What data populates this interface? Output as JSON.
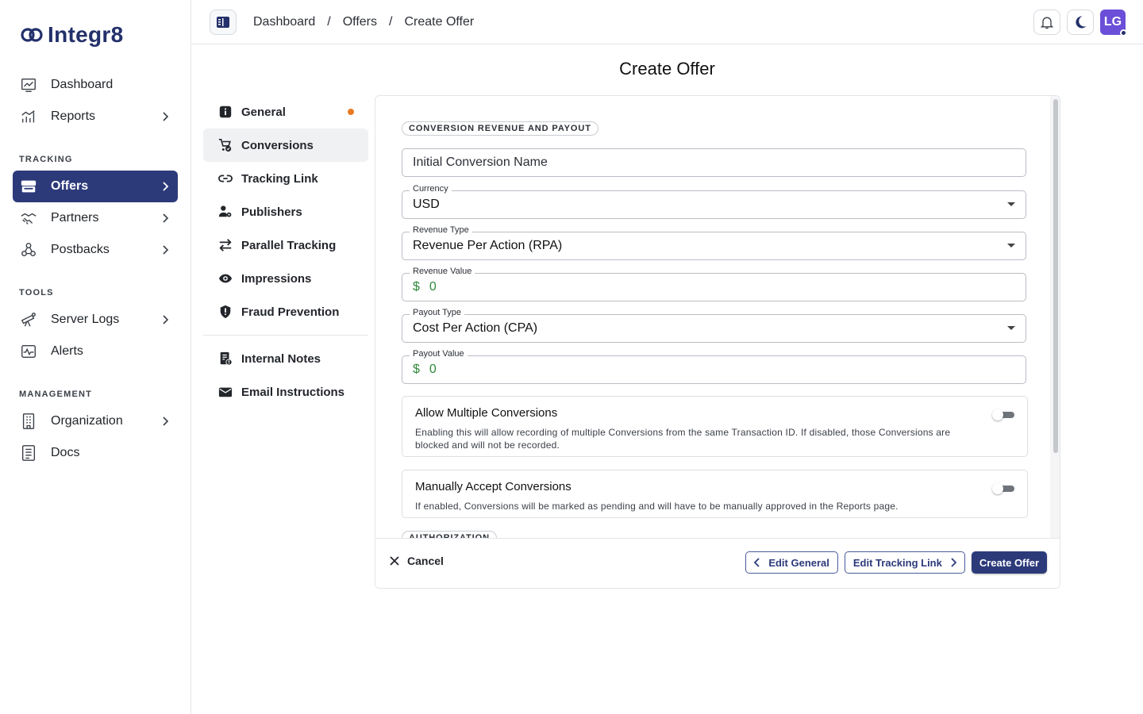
{
  "brand": {
    "name": "Integr8",
    "color": "#23306b"
  },
  "sidebar": {
    "items_top": [
      {
        "label": "Dashboard",
        "icon": "chart-line-icon"
      },
      {
        "label": "Reports",
        "icon": "bar-chart-icon"
      }
    ],
    "sections": [
      {
        "title": "TRACKING",
        "items": [
          {
            "label": "Offers",
            "icon": "storefront-icon",
            "active": true
          },
          {
            "label": "Partners",
            "icon": "handshake-icon"
          },
          {
            "label": "Postbacks",
            "icon": "webhook-icon"
          }
        ]
      },
      {
        "title": "TOOLS",
        "items": [
          {
            "label": "Server Logs",
            "icon": "telescope-icon"
          },
          {
            "label": "Alerts",
            "icon": "pulse-icon"
          }
        ]
      },
      {
        "title": "MANAGEMENT",
        "items": [
          {
            "label": "Organization",
            "icon": "building-icon"
          },
          {
            "label": "Docs",
            "icon": "document-icon"
          }
        ]
      }
    ]
  },
  "header": {
    "breadcrumb": [
      "Dashboard",
      "Offers",
      "Create Offer"
    ],
    "separator": "/",
    "avatar_initials": "LG"
  },
  "page": {
    "title": "Create Offer"
  },
  "subnav": {
    "items": [
      {
        "label": "General",
        "icon": "info-icon",
        "dot": true
      },
      {
        "label": "Conversions",
        "icon": "cart-icon",
        "active": true
      },
      {
        "label": "Tracking Link",
        "icon": "link-icon"
      },
      {
        "label": "Publishers",
        "icon": "user-gear-icon"
      },
      {
        "label": "Parallel Tracking",
        "icon": "arrows-swap-icon"
      },
      {
        "label": "Impressions",
        "icon": "eye-icon"
      },
      {
        "label": "Fraud Prevention",
        "icon": "shield-icon"
      }
    ],
    "items_bottom": [
      {
        "label": "Internal Notes",
        "icon": "notes-icon"
      },
      {
        "label": "Email Instructions",
        "icon": "envelope-icon"
      }
    ]
  },
  "form": {
    "section1": "CONVERSION REVENUE AND PAYOUT",
    "conversion_name_placeholder": "Initial Conversion Name",
    "currency": {
      "label": "Currency",
      "value": "USD"
    },
    "revenue_type": {
      "label": "Revenue Type",
      "value": "Revenue Per Action (RPA)"
    },
    "revenue_value": {
      "label": "Revenue Value",
      "prefix": "$",
      "value": "0"
    },
    "payout_type": {
      "label": "Payout Type",
      "value": "Cost Per Action (CPA)"
    },
    "payout_value": {
      "label": "Payout Value",
      "prefix": "$",
      "value": "0"
    },
    "allow_multiple": {
      "title": "Allow Multiple Conversions",
      "desc": "Enabling this will allow recording of multiple Conversions from the same Transaction ID. If disabled, those Conversions are blocked and will not be recorded.",
      "enabled": false
    },
    "manual_accept": {
      "title": "Manually Accept Conversions",
      "desc": "If enabled, Conversions will be marked as pending and will have to be manually approved in the Reports page.",
      "enabled": false
    },
    "section2": "AUTHORIZATION"
  },
  "footer": {
    "cancel": "Cancel",
    "prev": "Edit General",
    "next": "Edit Tracking Link",
    "submit": "Create Offer"
  },
  "colors": {
    "primary": "#2c3a7a",
    "dot": "#e87a22",
    "money": "#2f8a3a"
  }
}
